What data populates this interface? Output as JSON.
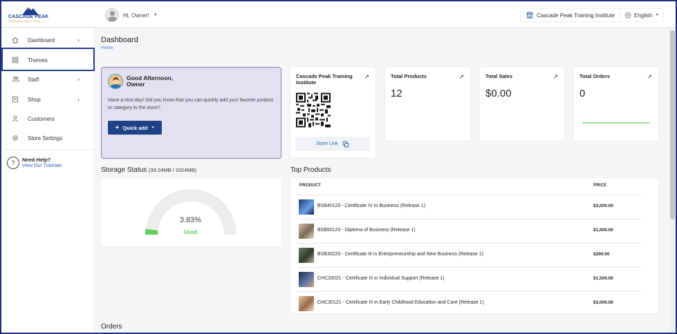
{
  "header": {
    "brand": "CASCADE PEAK",
    "brand_tagline": "TRAINING INSTITUTE",
    "greeting": "Hi, Owner!",
    "institute": "Cascade Peak Training Institute",
    "language": "English"
  },
  "sidebar": {
    "items": [
      {
        "label": "Dashboard",
        "icon": "home-icon",
        "has_arrow": true
      },
      {
        "label": "Themes",
        "icon": "themes-icon",
        "has_arrow": false
      },
      {
        "label": "Staff",
        "icon": "staff-icon",
        "has_arrow": true
      },
      {
        "label": "Shop",
        "icon": "shop-icon",
        "has_arrow": true
      },
      {
        "label": "Customers",
        "icon": "customer-icon",
        "has_arrow": false
      },
      {
        "label": "Store Settings",
        "icon": "settings-icon",
        "has_arrow": false
      }
    ],
    "help_title": "Need Help?",
    "help_link": "View Our Tutorials"
  },
  "main": {
    "title": "Dashboard",
    "breadcrumb": "Home",
    "welcome": {
      "greeting": "Good Afternoon,",
      "name": "Owner",
      "text": "Have a nice day! Did you know that you can quickly add your favorite product or category to the store?",
      "button": "Quick add"
    },
    "store_card": {
      "title": "Cascade Peak Training Institute",
      "link_label": "Store Link"
    },
    "stats": [
      {
        "title": "Total Products",
        "value": "12"
      },
      {
        "title": "Total Sales",
        "value": "$0.00"
      },
      {
        "title": "Total Orders",
        "value": "0"
      }
    ],
    "storage": {
      "title": "Storage Status",
      "detail": "(39.24MB / 1024MB)",
      "percent_label": "3.83%",
      "used_label": "Used",
      "used_fraction": 0.0383
    },
    "top_products": {
      "title": "Top Products",
      "col_product": "PRODUCT",
      "col_price": "PRICE",
      "rows": [
        {
          "name": "BSB40120 - Certificate IV In Business (Release 1)",
          "price": "$3,000.00",
          "thumb": "#2a4f8f"
        },
        {
          "name": "BSB50120 - Diploma of Business (Release 1)",
          "price": "$1,000.00",
          "thumb": "#8a7a62"
        },
        {
          "name": "BSB30220 - Certificate III in Entrepreneurship and New Business (Release 1)",
          "price": "$200.00",
          "thumb": "#4d5a4a"
        },
        {
          "name": "CHC33021 - Certificate III in Individual Support (Release 1)",
          "price": "$1,500.00",
          "thumb": "#3a4a6a"
        },
        {
          "name": "CHC30121 - Certificate III in Early Childhood Education and Care (Release 1)",
          "price": "$3,000.00",
          "thumb": "#b08a6a"
        }
      ]
    },
    "orders_title": "Orders"
  },
  "colors": {
    "accent": "#1d4288",
    "welcome_bg": "#e3e0f0",
    "used_green": "#5ecf5e"
  }
}
